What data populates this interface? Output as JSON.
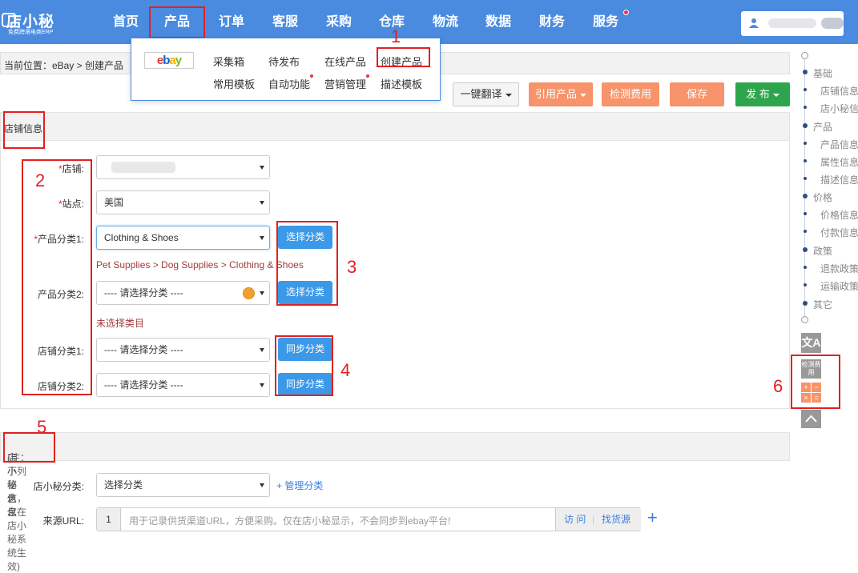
{
  "brand": {
    "name": "店小秘",
    "tagline": "免费跨境电商ERP"
  },
  "nav": [
    "首页",
    "产品",
    "订单",
    "客服",
    "采购",
    "仓库",
    "物流",
    "数据",
    "财务",
    "服务"
  ],
  "breadcrumb": {
    "label": "当前位置：",
    "path": "eBay > 创建产品"
  },
  "dropdown": {
    "platform": "ebay",
    "row1": [
      "采集箱",
      "待发布",
      "在线产品",
      "创建产品"
    ],
    "row2": [
      "常用模板",
      "自动功能",
      "营销管理",
      "描述模板"
    ]
  },
  "toolbar": {
    "translate": "一键翻译",
    "cite": "引用产品",
    "fee": "检测费用",
    "save": "保存",
    "publish": "发 布"
  },
  "section1": {
    "title": "店铺信息",
    "store_label": "店铺:",
    "site_label": "站点:",
    "site_value": "美国",
    "cat1_label": "产品分类1:",
    "cat1_value": "Clothing & Shoes",
    "cat1_path": "Pet Supplies > Dog Supplies > Clothing & Shoes",
    "cat2_label": "产品分类2:",
    "cat2_value": "---- 请选择分类 ----",
    "cat2_empty": "未选择类目",
    "shopcat1_label": "店铺分类1:",
    "shopcat1_value": "---- 请选择分类 ----",
    "shopcat2_label": "店铺分类2:",
    "shopcat2_value": "---- 请选择分类 ----",
    "choose_btn": "选择分类",
    "sync_btn": "同步分类"
  },
  "section2": {
    "title": "店小秘信息",
    "note": "(注：下列信息，仅在店小秘系统生效)",
    "cat_label": "店小秘分类:",
    "cat_value": "选择分类",
    "manage_link": "+ 管理分类",
    "url_label": "来源URL:",
    "url_index": "1",
    "url_placeholder": "用于记录供货渠道URL，方便采购。仅在店小秘显示，不会同步到ebay平台!",
    "visit": "访 问",
    "find_source": "找货源"
  },
  "rightnav": {
    "groups": [
      "基础",
      "产品",
      "价格",
      "政策",
      "其它"
    ],
    "basic_items": [
      "店铺信息",
      "店小秘信"
    ],
    "product_items": [
      "产品信息",
      "属性信息",
      "描述信息"
    ],
    "price_items": [
      "价格信息",
      "付款信息"
    ],
    "policy_items": [
      "退款政策",
      "运输政策"
    ],
    "fee_icon": "检测费用"
  },
  "annotations": [
    "1",
    "2",
    "3",
    "4",
    "5",
    "6"
  ],
  "colors": {
    "header": "#4a8be0",
    "blue_btn": "#3b99e8",
    "orange_btn": "#f7946b",
    "green_btn": "#2ea54c",
    "annotation_red": "#e32020"
  }
}
